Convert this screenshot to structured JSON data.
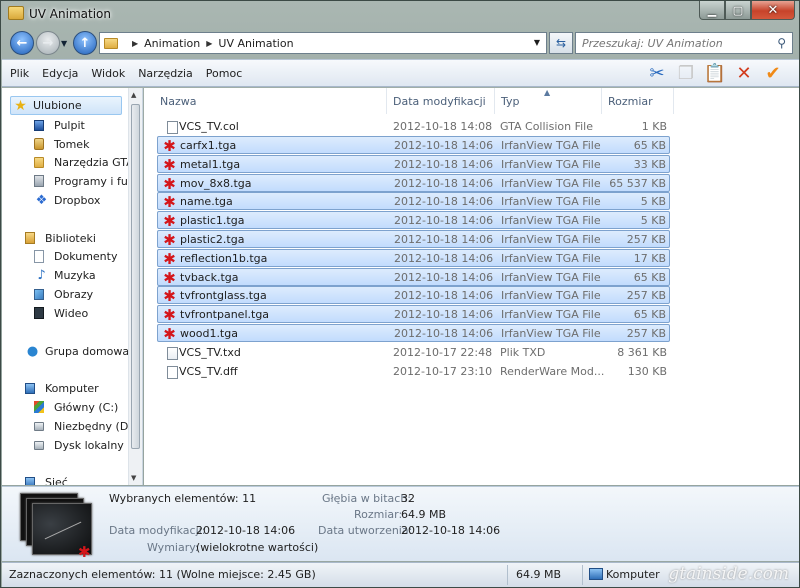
{
  "window": {
    "title": "UV Animation"
  },
  "address": {
    "crumbs": [
      "Animation",
      "UV Animation"
    ],
    "search_placeholder": "Przeszukaj: UV Animation"
  },
  "menu": [
    "Plik",
    "Edycja",
    "Widok",
    "Narzędzia",
    "Pomoc"
  ],
  "toolbar_icons": [
    "scissors-icon",
    "copy-icon",
    "paste-icon",
    "delete-icon",
    "checkmark-icon"
  ],
  "nav": [
    {
      "label": "Ulubione",
      "icon": "star-icon",
      "selected": true
    },
    {
      "label": "Pulpit",
      "icon": "desktop-icon"
    },
    {
      "label": "Tomek",
      "icon": "user-folder-icon"
    },
    {
      "label": "Narzędzia GTA",
      "icon": "folder-icon"
    },
    {
      "label": "Programy i funk",
      "icon": "programs-icon"
    },
    {
      "label": "Dropbox",
      "icon": "dropbox-icon"
    },
    {
      "label": "Biblioteki",
      "icon": "libraries-icon"
    },
    {
      "label": "Dokumenty",
      "icon": "documents-icon"
    },
    {
      "label": "Muzyka",
      "icon": "music-icon"
    },
    {
      "label": "Obrazy",
      "icon": "pictures-icon"
    },
    {
      "label": "Wideo",
      "icon": "video-icon"
    },
    {
      "label": "Grupa domowa",
      "icon": "homegroup-icon"
    },
    {
      "label": "Komputer",
      "icon": "computer-icon"
    },
    {
      "label": "Główny (C:)",
      "icon": "windows-drive-icon"
    },
    {
      "label": "Niezbędny (D:)",
      "icon": "drive-icon"
    },
    {
      "label": "Dysk lokalny (G",
      "icon": "drive-icon"
    },
    {
      "label": "Sieć",
      "icon": "network-icon"
    }
  ],
  "columns": [
    "Nazwa",
    "Data modyfikacji",
    "Typ",
    "Rozmiar"
  ],
  "files": [
    {
      "name": "VCS_TV.col",
      "date": "2012-10-18 14:08",
      "type": "GTA Collision File",
      "size": "1 KB",
      "icon": "file-icon",
      "selected": false
    },
    {
      "name": "carfx1.tga",
      "date": "2012-10-18 14:06",
      "type": "IrfanView TGA File",
      "size": "65 KB",
      "icon": "irfanview-icon",
      "selected": true
    },
    {
      "name": "metal1.tga",
      "date": "2012-10-18 14:06",
      "type": "IrfanView TGA File",
      "size": "33 KB",
      "icon": "irfanview-icon",
      "selected": true
    },
    {
      "name": "mov_8x8.tga",
      "date": "2012-10-18 14:06",
      "type": "IrfanView TGA File",
      "size": "65 537 KB",
      "icon": "irfanview-icon",
      "selected": true
    },
    {
      "name": "name.tga",
      "date": "2012-10-18 14:06",
      "type": "IrfanView TGA File",
      "size": "5 KB",
      "icon": "irfanview-icon",
      "selected": true
    },
    {
      "name": "plastic1.tga",
      "date": "2012-10-18 14:06",
      "type": "IrfanView TGA File",
      "size": "5 KB",
      "icon": "irfanview-icon",
      "selected": true
    },
    {
      "name": "plastic2.tga",
      "date": "2012-10-18 14:06",
      "type": "IrfanView TGA File",
      "size": "257 KB",
      "icon": "irfanview-icon",
      "selected": true
    },
    {
      "name": "reflection1b.tga",
      "date": "2012-10-18 14:06",
      "type": "IrfanView TGA File",
      "size": "17 KB",
      "icon": "irfanview-icon",
      "selected": true
    },
    {
      "name": "tvback.tga",
      "date": "2012-10-18 14:06",
      "type": "IrfanView TGA File",
      "size": "65 KB",
      "icon": "irfanview-icon",
      "selected": true
    },
    {
      "name": "tvfrontglass.tga",
      "date": "2012-10-18 14:06",
      "type": "IrfanView TGA File",
      "size": "257 KB",
      "icon": "irfanview-icon",
      "selected": true
    },
    {
      "name": "tvfrontpanel.tga",
      "date": "2012-10-18 14:06",
      "type": "IrfanView TGA File",
      "size": "65 KB",
      "icon": "irfanview-icon",
      "selected": true
    },
    {
      "name": "wood1.tga",
      "date": "2012-10-18 14:06",
      "type": "IrfanView TGA File",
      "size": "257 KB",
      "icon": "irfanview-icon",
      "selected": true
    },
    {
      "name": "VCS_TV.txd",
      "date": "2012-10-17 22:48",
      "type": "Plik TXD",
      "size": "8 361 KB",
      "icon": "txd-file-icon",
      "selected": false
    },
    {
      "name": "VCS_TV.dff",
      "date": "2012-10-17 23:10",
      "type": "RenderWare Mod...",
      "size": "130 KB",
      "icon": "dff-file-icon",
      "selected": false
    }
  ],
  "details": {
    "selected_count_label": "Wybranych elementów: 11",
    "modified_label": "Data modyfikacji:",
    "modified_value": "2012-10-18 14:06",
    "dimensions_label": "Wymiary:",
    "dimensions_value": "(wielokrotne wartości)",
    "bitdepth_label": "Głębia w bitach:",
    "bitdepth_value": "32",
    "size_label": "Rozmiar:",
    "size_value": "64.9 MB",
    "created_label": "Data utworzenia:",
    "created_value": "2012-10-18 14:06"
  },
  "status": {
    "selection": "Zaznaczonych elementów: 11 (Wolne miejsce: 2.45 GB)",
    "size": "64.9 MB",
    "location": "Komputer",
    "watermark": "gtainside.com"
  }
}
